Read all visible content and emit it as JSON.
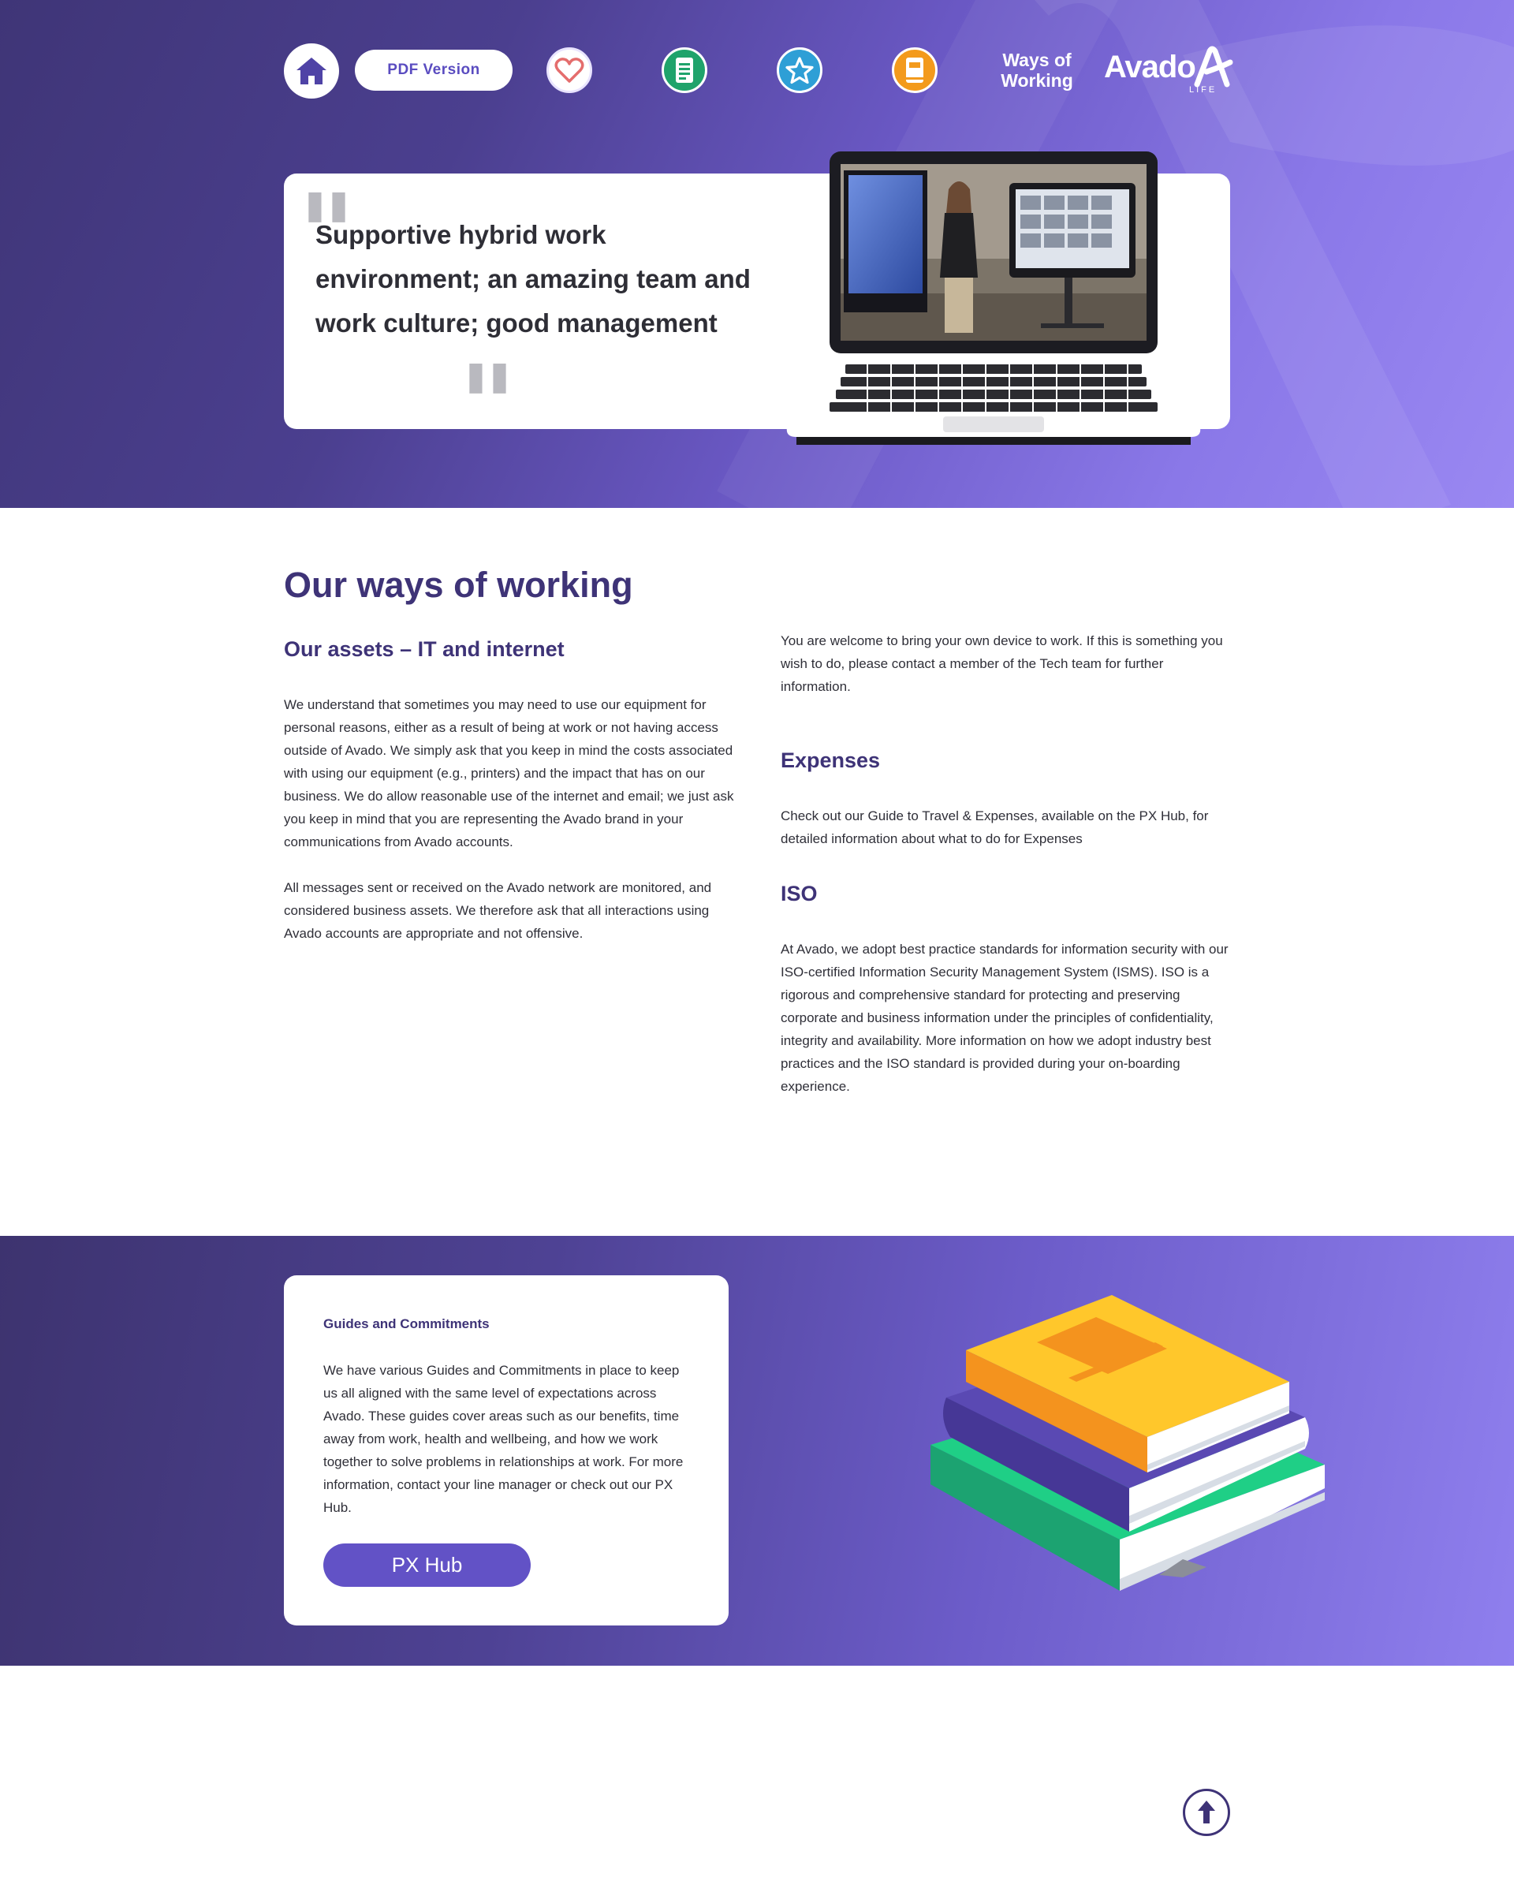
{
  "nav": {
    "pdf_label": "PDF Version",
    "ways_line1": "Ways of",
    "ways_line2": "Working",
    "logo_word": "Avado",
    "logo_sub": "LIFE",
    "icons": [
      "home-icon",
      "heart-icon",
      "document-icon",
      "star-icon",
      "book-icon"
    ],
    "icon_colors": {
      "heart": "#ffffff",
      "document": "#1fa36b",
      "star": "#2e9fd6",
      "book": "#f39a1c"
    }
  },
  "hero": {
    "quote": "Supportive hybrid work environment; an amazing team and work culture; good management"
  },
  "main": {
    "title": "Our ways of working",
    "assets": {
      "heading": "Our assets – IT and internet",
      "p1": "We understand that sometimes you may need to use our equipment for personal reasons, either as a result of being at work or not having access outside of Avado. We simply ask that you keep in mind the costs associated with using our equipment (e.g., printers) and the impact that has on our business. We do allow reasonable use of the internet and email; we just ask you keep in mind that you are representing the Avado brand in your communications from Avado accounts.",
      "p2": "All messages sent or received on the Avado network are monitored, and considered business assets. We therefore ask that all interactions using Avado accounts are appropriate and not offensive."
    },
    "byod": "You are welcome to bring your own device to work. If this is something you wish to do, please contact a member of the Tech team for further information.",
    "expenses": {
      "heading": "Expenses",
      "text": "Check out our Guide to Travel & Expenses, available on the PX Hub, for detailed information about what to do for Expenses"
    },
    "iso": {
      "heading": "ISO",
      "text": "At Avado, we adopt best practice standards for information security with our ISO-certified Information Security Management System (ISMS). ISO is a rigorous and comprehensive standard for protecting and preserving corporate and business information under the principles of confidentiality, integrity and availability. More information on how we adopt industry best practices and the ISO standard is provided during your on-boarding experience."
    }
  },
  "guides": {
    "title": "Guides and Commitments",
    "text": "We have various Guides and Commitments in place to keep us all aligned with the same level of expectations across Avado. These guides cover areas such as our benefits, time away from work, health and wellbeing, and how we work together to solve problems in relationships at work. For more information, contact your line manager or check out our PX Hub.",
    "button": "PX Hub"
  },
  "colors": {
    "brand_dark": "#3e3377",
    "brand_accent": "#6252c6",
    "hero_gradient_end": "#9a88f2"
  }
}
